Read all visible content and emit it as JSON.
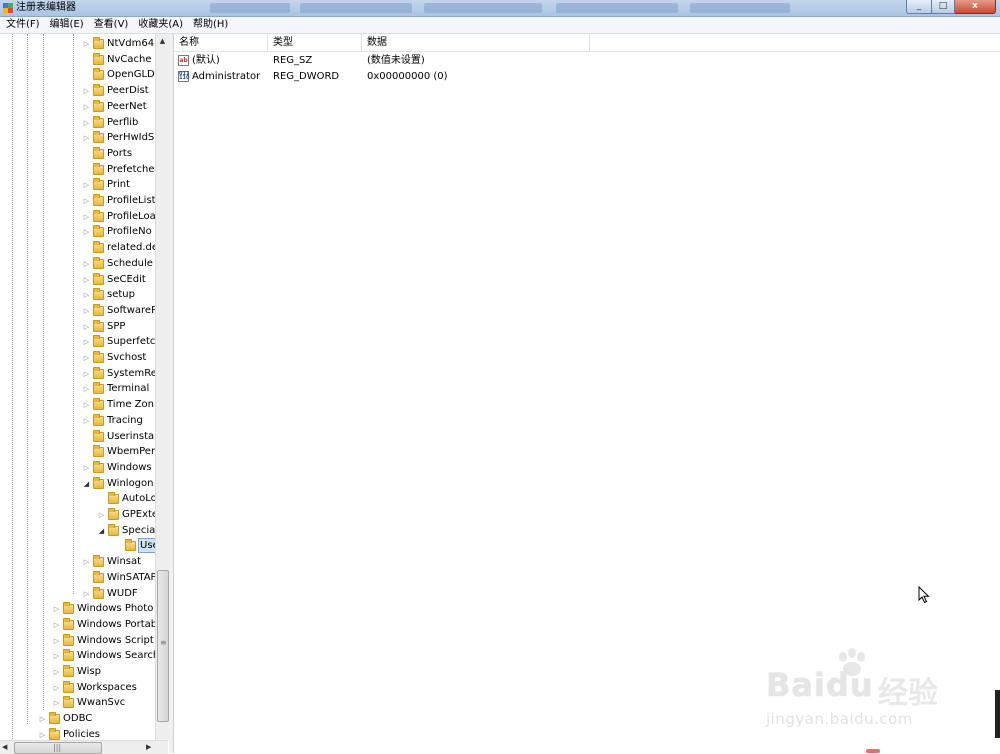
{
  "window": {
    "title": "注册表编辑器",
    "icon": "registry-editor-icon",
    "controls": {
      "minimize": "_",
      "maximize": "□",
      "close": "x"
    }
  },
  "menu": [
    "文件(F)",
    "编辑(E)",
    "查看(V)",
    "收藏夹(A)",
    "帮助(H)"
  ],
  "tree": [
    {
      "label": "NtVdm64",
      "level": 3,
      "expand": "collapsed"
    },
    {
      "label": "NvCache",
      "level": 3,
      "expand": "none"
    },
    {
      "label": "OpenGLD",
      "level": 3,
      "expand": "none"
    },
    {
      "label": "PeerDist",
      "level": 3,
      "expand": "collapsed"
    },
    {
      "label": "PeerNet",
      "level": 3,
      "expand": "collapsed"
    },
    {
      "label": "Perflib",
      "level": 3,
      "expand": "collapsed"
    },
    {
      "label": "PerHwIdS",
      "level": 3,
      "expand": "collapsed"
    },
    {
      "label": "Ports",
      "level": 3,
      "expand": "none"
    },
    {
      "label": "Prefetche",
      "level": 3,
      "expand": "none"
    },
    {
      "label": "Print",
      "level": 3,
      "expand": "collapsed"
    },
    {
      "label": "ProfileList",
      "level": 3,
      "expand": "collapsed"
    },
    {
      "label": "ProfileLoa",
      "level": 3,
      "expand": "collapsed"
    },
    {
      "label": "ProfileNo",
      "level": 3,
      "expand": "collapsed"
    },
    {
      "label": "related.de",
      "level": 3,
      "expand": "none"
    },
    {
      "label": "Schedule",
      "level": 3,
      "expand": "collapsed"
    },
    {
      "label": "SeCEdit",
      "level": 3,
      "expand": "collapsed"
    },
    {
      "label": "setup",
      "level": 3,
      "expand": "collapsed"
    },
    {
      "label": "SoftwareP",
      "level": 3,
      "expand": "collapsed"
    },
    {
      "label": "SPP",
      "level": 3,
      "expand": "collapsed"
    },
    {
      "label": "Superfetc",
      "level": 3,
      "expand": "collapsed"
    },
    {
      "label": "Svchost",
      "level": 3,
      "expand": "collapsed"
    },
    {
      "label": "SystemRe",
      "level": 3,
      "expand": "collapsed"
    },
    {
      "label": "Terminal",
      "level": 3,
      "expand": "collapsed"
    },
    {
      "label": "Time Zon",
      "level": 3,
      "expand": "collapsed"
    },
    {
      "label": "Tracing",
      "level": 3,
      "expand": "collapsed"
    },
    {
      "label": "Userinsta",
      "level": 3,
      "expand": "none"
    },
    {
      "label": "WbemPer",
      "level": 3,
      "expand": "none"
    },
    {
      "label": "Windows",
      "level": 3,
      "expand": "collapsed"
    },
    {
      "label": "Winlogon",
      "level": 3,
      "expand": "expanded"
    },
    {
      "label": "AutoLo",
      "level": 4,
      "expand": "none"
    },
    {
      "label": "GPExte",
      "level": 4,
      "expand": "collapsed"
    },
    {
      "label": "Specia",
      "level": 4,
      "expand": "expanded"
    },
    {
      "label": "Use",
      "level": 5,
      "expand": "none",
      "selected": true
    },
    {
      "label": "Winsat",
      "level": 3,
      "expand": "collapsed"
    },
    {
      "label": "WinSATAP",
      "level": 3,
      "expand": "none"
    },
    {
      "label": "WUDF",
      "level": 3,
      "expand": "collapsed"
    },
    {
      "label": "Windows Photo",
      "level": 2,
      "expand": "collapsed"
    },
    {
      "label": "Windows Portab",
      "level": 2,
      "expand": "collapsed"
    },
    {
      "label": "Windows Script",
      "level": 2,
      "expand": "collapsed"
    },
    {
      "label": "Windows Search",
      "level": 2,
      "expand": "collapsed"
    },
    {
      "label": "Wisp",
      "level": 2,
      "expand": "collapsed"
    },
    {
      "label": "Workspaces",
      "level": 2,
      "expand": "collapsed"
    },
    {
      "label": "WwanSvc",
      "level": 2,
      "expand": "collapsed"
    },
    {
      "label": "ODBC",
      "level": 1,
      "expand": "collapsed"
    },
    {
      "label": "Policies",
      "level": 1,
      "expand": "collapsed"
    }
  ],
  "list": {
    "columns": [
      "名称",
      "类型",
      "数据"
    ],
    "rows": [
      {
        "icon": "string-value-icon",
        "icon_text": "ab",
        "name": "(默认)",
        "type": "REG_SZ",
        "data": "(数值未设置)"
      },
      {
        "icon": "binary-value-icon",
        "icon_text": "011 110",
        "name": "Administrator",
        "type": "REG_DWORD",
        "data": "0x00000000 (0)"
      }
    ]
  },
  "watermark": {
    "brand": "Bai",
    "brand_tail": "du",
    "brand_cn": "经验",
    "url": "jingyan.baidu.com"
  },
  "colors": {
    "selection": "#cde4f7",
    "folder": "#e7b83e",
    "titlebar": "#a9c3e2",
    "close": "#c84a32"
  }
}
